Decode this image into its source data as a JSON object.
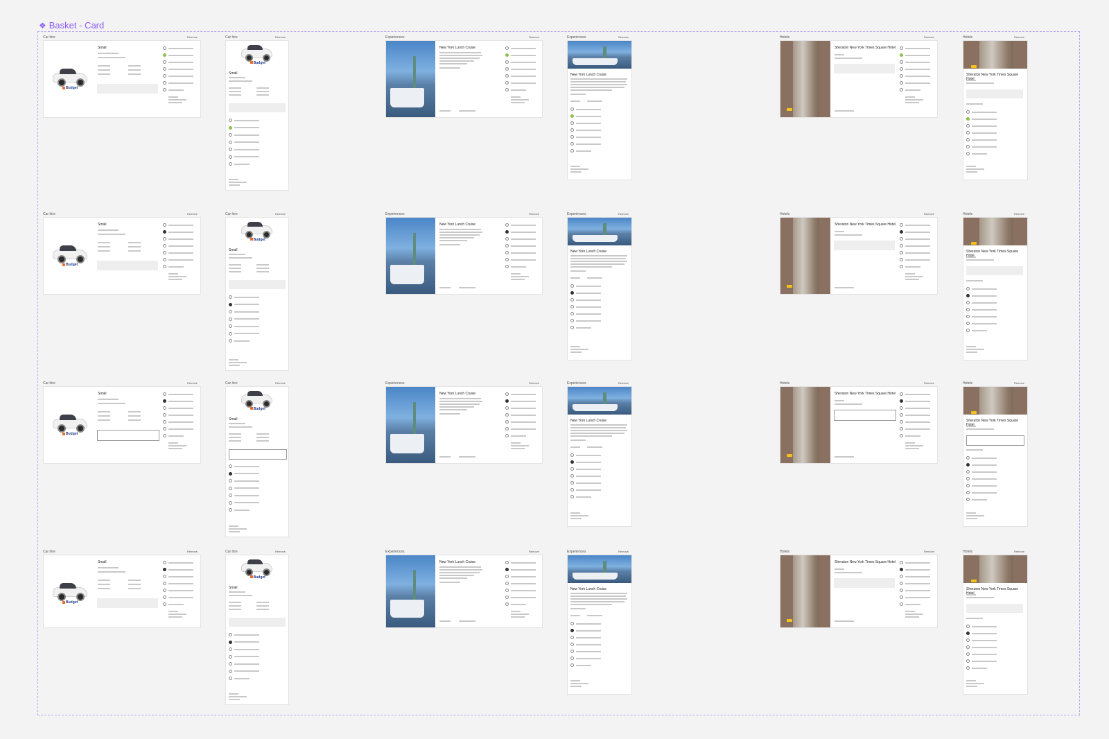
{
  "frame": {
    "title": "Basket - Card",
    "icon": "component-diamond-icon",
    "accent": "#8b5cf6"
  },
  "labels": {
    "car_hire": "Car hire",
    "experiences": "Experiences",
    "hotels": "Hotels",
    "remove": "Remove"
  },
  "car": {
    "name": "Small",
    "brand": "Budget"
  },
  "experience": {
    "name": "New York Lunch Cruise"
  },
  "hotel": {
    "name": "Sheraton New York Times Square Hotel"
  },
  "rows": 4,
  "radio_options": 8,
  "colors": {
    "selected_radio": "#8bc34a",
    "selected_radio_dark": "#333333",
    "budget_orange": "#f26b21",
    "budget_blue": "#1b3a8c"
  }
}
